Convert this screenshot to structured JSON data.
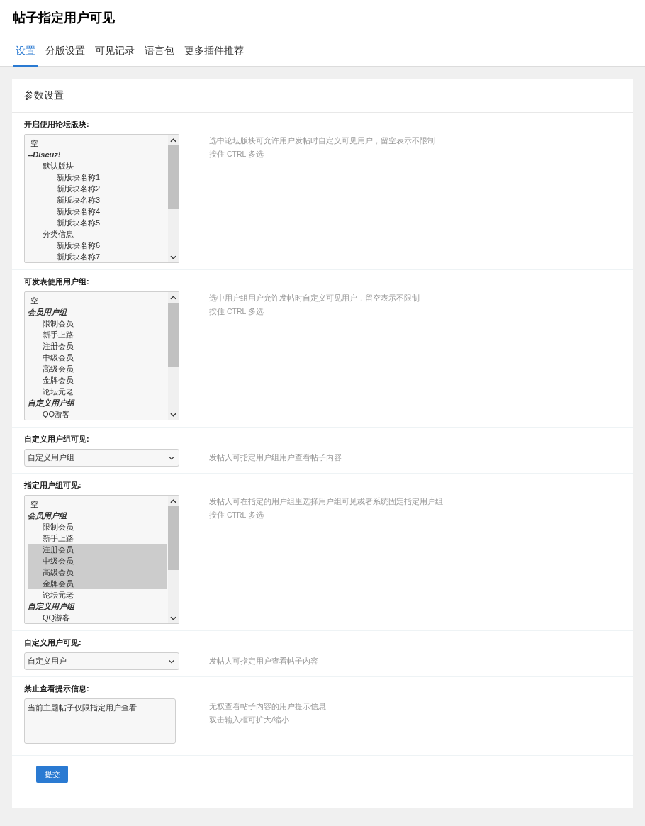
{
  "page_title": "帖子指定用户可见",
  "tabs": [
    {
      "label": "设置",
      "selected": true
    },
    {
      "label": "分版设置",
      "selected": false
    },
    {
      "label": "可见记录",
      "selected": false
    },
    {
      "label": "语言包",
      "selected": false
    },
    {
      "label": "更多插件推荐",
      "selected": false
    }
  ],
  "panel": {
    "title": "参数设置",
    "settings": [
      {
        "label": "开启使用论坛版块:",
        "kind": "listbox",
        "options": [
          {
            "text": "空",
            "kind": "option",
            "selected": false
          },
          {
            "text": "--Discuz!",
            "kind": "group",
            "selected": false,
            "children": [
              {
                "text": "默认版块",
                "kind": "option",
                "selected": false,
                "children": [
                  {
                    "text": "新版块名称1",
                    "kind": "option",
                    "selected": false
                  },
                  {
                    "text": "新版块名称2",
                    "kind": "option",
                    "selected": false
                  },
                  {
                    "text": "新版块名称3",
                    "kind": "option",
                    "selected": false
                  },
                  {
                    "text": "新版块名称4",
                    "kind": "option",
                    "selected": false
                  },
                  {
                    "text": "新版块名称5",
                    "kind": "option",
                    "selected": false
                  }
                ]
              },
              {
                "text": "分类信息",
                "kind": "option",
                "selected": false,
                "children": [
                  {
                    "text": "新版块名称6",
                    "kind": "option",
                    "selected": false
                  },
                  {
                    "text": "新版块名称7",
                    "kind": "option",
                    "selected": false
                  }
                ]
              }
            ]
          }
        ],
        "hints": [
          "选中论坛版块可允许用户发帖时自定义可见用户，留空表示不限制",
          "按住 CTRL 多选"
        ]
      },
      {
        "label": "可发表使用用户组:",
        "kind": "listbox",
        "options": [
          {
            "text": "空",
            "kind": "option",
            "selected": false
          },
          {
            "text": "会员用户组",
            "kind": "group",
            "selected": false,
            "children": [
              {
                "text": "限制会员",
                "kind": "option",
                "selected": false
              },
              {
                "text": "新手上路",
                "kind": "option",
                "selected": false
              },
              {
                "text": "注册会员",
                "kind": "option",
                "selected": false
              },
              {
                "text": "中级会员",
                "kind": "option",
                "selected": false
              },
              {
                "text": "高级会员",
                "kind": "option",
                "selected": false
              },
              {
                "text": "金牌会员",
                "kind": "option",
                "selected": false
              },
              {
                "text": "论坛元老",
                "kind": "option",
                "selected": false
              }
            ]
          },
          {
            "text": "自定义用户组",
            "kind": "group",
            "selected": false,
            "children": [
              {
                "text": "QQ游客",
                "kind": "option",
                "selected": false
              }
            ]
          }
        ],
        "hints": [
          "选中用户组用户允许发帖时自定义可见用户，留空表示不限制",
          "按住 CTRL 多选"
        ]
      },
      {
        "label": "自定义用户组可见:",
        "kind": "select",
        "value": "自定义用户组",
        "hints": [
          "发帖人可指定用户组用户查看帖子内容"
        ]
      },
      {
        "label": "指定用户组可见:",
        "kind": "listbox",
        "options": [
          {
            "text": "空",
            "kind": "option",
            "selected": false
          },
          {
            "text": "会员用户组",
            "kind": "group",
            "selected": false,
            "children": [
              {
                "text": "限制会员",
                "kind": "option",
                "selected": false
              },
              {
                "text": "新手上路",
                "kind": "option",
                "selected": false
              },
              {
                "text": "注册会员",
                "kind": "option",
                "selected": true
              },
              {
                "text": "中级会员",
                "kind": "option",
                "selected": true
              },
              {
                "text": "高级会员",
                "kind": "option",
                "selected": true
              },
              {
                "text": "金牌会员",
                "kind": "option",
                "selected": true
              },
              {
                "text": "论坛元老",
                "kind": "option",
                "selected": false
              }
            ]
          },
          {
            "text": "自定义用户组",
            "kind": "group",
            "selected": false,
            "children": [
              {
                "text": "QQ游客",
                "kind": "option",
                "selected": false
              }
            ]
          }
        ],
        "hints": [
          "发帖人可在指定的用户组里选择用户组可见或者系统固定指定用户组",
          "按住 CTRL 多选"
        ]
      },
      {
        "label": "自定义用户可见:",
        "kind": "select",
        "value": "自定义用户",
        "hints": [
          "发帖人可指定用户查看帖子内容"
        ]
      },
      {
        "label": "禁止查看提示信息:",
        "kind": "textarea",
        "value": "当前主题帖子仅限指定用户查看",
        "hints": [
          "无权查看帖子内容的用户提示信息",
          "双击输入框可扩大/缩小"
        ]
      }
    ],
    "submit": "提交"
  }
}
